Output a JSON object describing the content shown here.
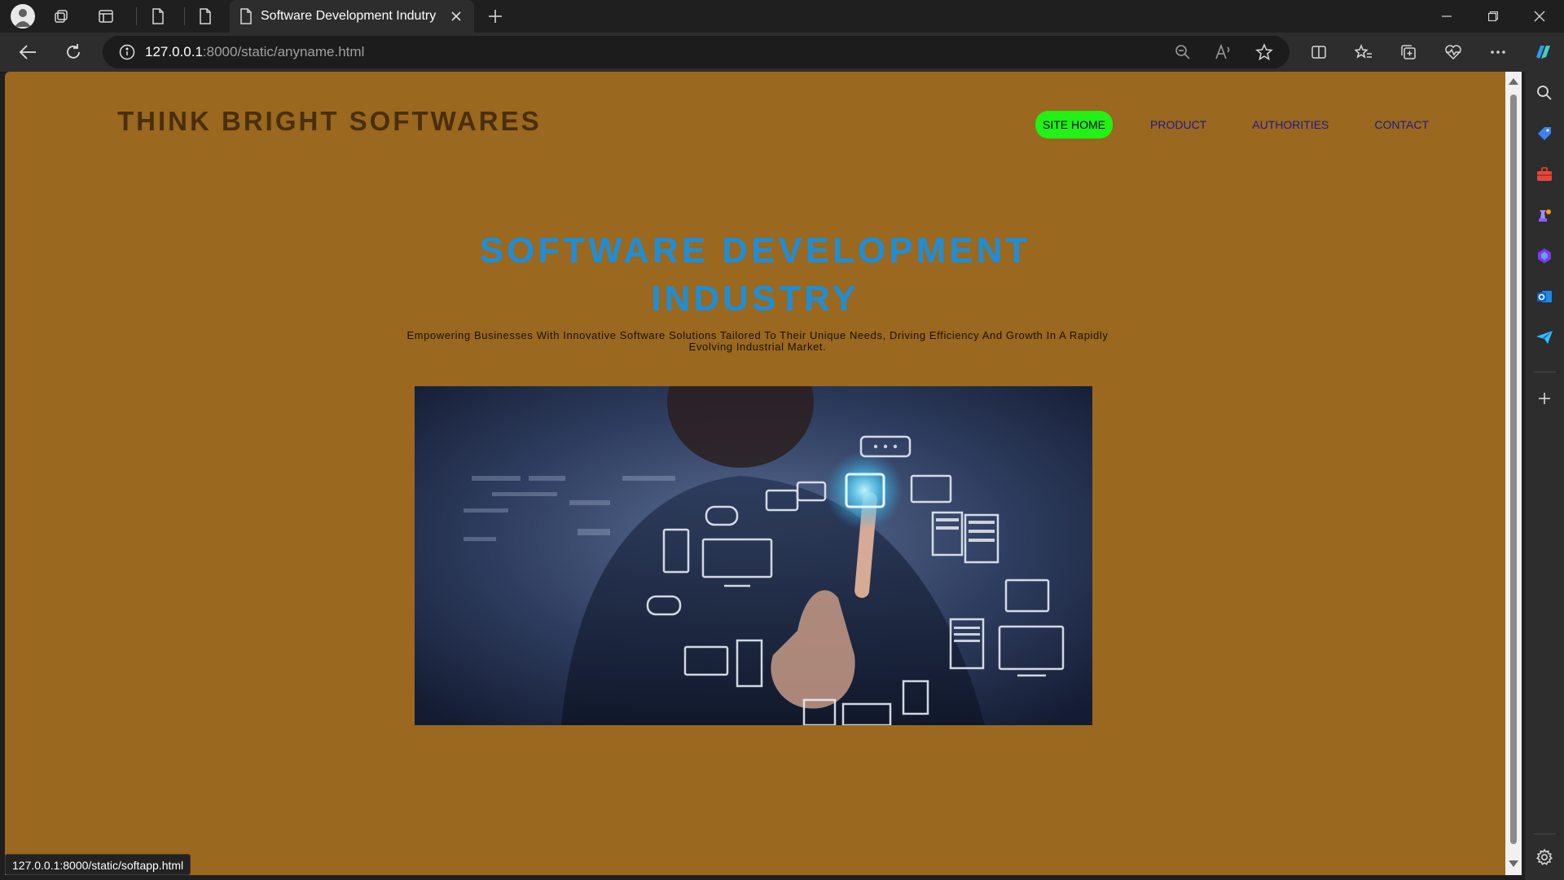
{
  "browser": {
    "tab_title": "Software Development Indutry",
    "url_host": "127.0.0.1",
    "url_rest": ":8000/static/anyname.html",
    "status_url": "127.0.0.1:8000/static/softapp.html"
  },
  "site": {
    "brand": "THINK BRIGHT SOFTWARES",
    "nav": [
      {
        "label": "SITE HOME",
        "active": true
      },
      {
        "label": "PRODUCT",
        "active": false
      },
      {
        "label": "AUTHORITIES",
        "active": false
      },
      {
        "label": "CONTACT",
        "active": false
      }
    ],
    "hero_title_line1": "SOFTWARE DEVELOPMENT",
    "hero_title_line2": "INDUSTRY",
    "hero_subtitle": "Empowering Businesses With Innovative Software Solutions Tailored To Their Unique Needs, Driving Efficiency And Growth In A Rapidly Evolving Industrial Market."
  },
  "colors": {
    "page_bg": "#9a681e",
    "brand_text": "#4a2f0d",
    "nav_text": "#1f1a8c",
    "nav_active_bg": "#23f015",
    "hero_title": "#1e8ed8"
  },
  "icons": {
    "sidebar": [
      "search-icon",
      "tag-icon",
      "briefcase-icon",
      "chess-icon",
      "copilot-app-icon",
      "outlook-icon",
      "send-icon",
      "add-icon",
      "settings-icon"
    ]
  }
}
